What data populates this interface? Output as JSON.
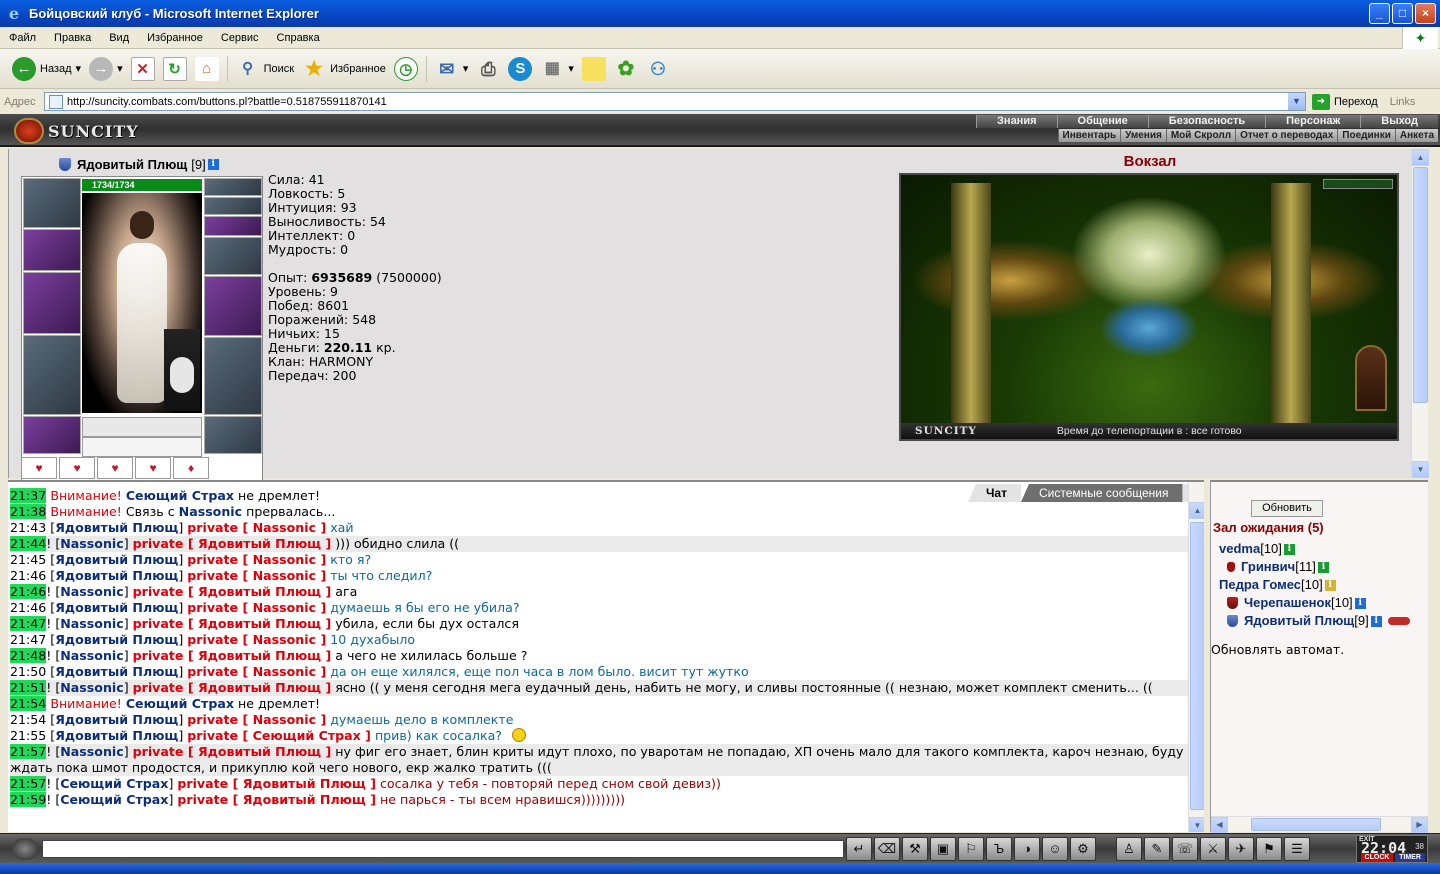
{
  "window": {
    "title": "Бойцовский клуб - Microsoft Internet Explorer",
    "btn_min": "_",
    "btn_max": "□",
    "btn_close": "×"
  },
  "menu": [
    "Файл",
    "Правка",
    "Вид",
    "Избранное",
    "Сервис",
    "Справка"
  ],
  "toolbar": {
    "back": "Назад",
    "search": "Поиск",
    "favorites": "Избранное"
  },
  "address": {
    "label": "Адрес",
    "url": "http://suncity.combats.com/buttons.pl?battle=0.518755911870141",
    "go": "Переход",
    "links": "Links"
  },
  "game_nav": {
    "logo": "SUNCITY",
    "row1": [
      "Знания",
      "Общение",
      "Безопасность",
      "Персонаж",
      "Выход"
    ],
    "row2": [
      "Инвентарь",
      "Умения",
      "Мой Скролл",
      "Отчет о переводах",
      "Поединки",
      "Анкета"
    ]
  },
  "character": {
    "name": "Ядовитый Плющ",
    "level": "[9]",
    "hp": "1734/1734",
    "stats": [
      {
        "label": "Сила:",
        "value": "41"
      },
      {
        "label": "Ловкость:",
        "value": "5"
      },
      {
        "label": "Интуиция:",
        "value": "93"
      },
      {
        "label": "Выносливость:",
        "value": "54"
      },
      {
        "label": "Интеллект:",
        "value": "0"
      },
      {
        "label": "Мудрость:",
        "value": "0"
      }
    ],
    "exp_label": "Опыт:",
    "exp_value": "6935689",
    "exp_next": "(7500000)",
    "level_label": "Уровень:",
    "level_value": "9",
    "wins_label": "Побед:",
    "wins_value": "8601",
    "losses_label": "Поражений:",
    "losses_value": "548",
    "draws_label": "Ничьих:",
    "draws_value": "15",
    "money_label": "Деньги:",
    "money_value": "220.11",
    "money_unit": "кр.",
    "clan_label": "Клан:",
    "clan_value": "HARMONY",
    "transfers_label": "Передач:",
    "transfers_value": "200"
  },
  "location": {
    "title": "Вокзал",
    "logo": "SUNCITY",
    "teleport": "Время до телепортации в : все готово"
  },
  "chat_tabs": {
    "chat": "Чат",
    "system": "Системные сообщения"
  },
  "chat": [
    {
      "t": "21:37",
      "green": true,
      "kind": "warn",
      "pre": "Внимание! ",
      "nick": "Сеющий Страх",
      "text": " не дремлет!"
    },
    {
      "t": "21:38",
      "green": true,
      "kind": "warn2",
      "pre": "Внимание! ",
      "text1": "Связь с ",
      "nick": "Nassonic",
      "text": " прервалась..."
    },
    {
      "t": "21:43",
      "green": false,
      "from": "Ядовитый Плющ",
      "to": "Nassonic",
      "msg": "хай",
      "mc": "msg-blue"
    },
    {
      "t": "21:44",
      "green": true,
      "from": "Nassonic",
      "to": "Ядовитый Плющ",
      "msg": "))) обидно слила ((",
      "mc": "",
      "hl": true
    },
    {
      "t": "21:45",
      "green": false,
      "from": "Ядовитый Плющ",
      "to": "Nassonic",
      "msg": "кто я?",
      "mc": "msg-blue"
    },
    {
      "t": "21:46",
      "green": false,
      "from": "Ядовитый Плющ",
      "to": "Nassonic",
      "msg": "ты что следил?",
      "mc": "msg-blue"
    },
    {
      "t": "21:46",
      "green": true,
      "from": "Nassonic",
      "to": "Ядовитый Плющ",
      "msg": "ага",
      "mc": ""
    },
    {
      "t": "21:46",
      "green": false,
      "from": "Ядовитый Плющ",
      "to": "Nassonic",
      "msg": "думаешь я бы его не убила?",
      "mc": "msg-blue"
    },
    {
      "t": "21:47",
      "green": true,
      "from": "Nassonic",
      "to": "Ядовитый Плющ",
      "msg": "убила, если бы дух остался",
      "mc": ""
    },
    {
      "t": "21:47",
      "green": false,
      "from": "Ядовитый Плющ",
      "to": "Nassonic",
      "msg": "10 духабыло",
      "mc": "msg-blue"
    },
    {
      "t": "21:48",
      "green": true,
      "from": "Nassonic",
      "to": "Ядовитый Плющ",
      "msg": "а чего не хилилась больше ?",
      "mc": ""
    },
    {
      "t": "21:50",
      "green": false,
      "from": "Ядовитый Плющ",
      "to": "Nassonic",
      "msg": "да он еще хилялся, еще пол часа в лом было. висит тут жутко",
      "mc": "msg-blue"
    },
    {
      "t": "21:51",
      "green": true,
      "from": "Nassonic",
      "to": "Ядовитый Плющ",
      "msg": "ясно (( у меня сегодня мега еудачный день, набить не могу, и сливы постоянные (( незнаю, может комплект сменить... ((",
      "mc": "",
      "wrap": true
    },
    {
      "t": "21:54",
      "green": true,
      "kind": "warn",
      "pre": "Внимание! ",
      "nick": "Сеющий Страх",
      "text": " не дремлет!"
    },
    {
      "t": "21:54",
      "green": false,
      "from": "Ядовитый Плющ",
      "to": "Nassonic",
      "msg": "думаешь дело в комплекте",
      "mc": "msg-blue"
    },
    {
      "t": "21:55",
      "green": false,
      "from": "Ядовитый Плющ",
      "to": "Сеющий Страх",
      "msg": "прив) как сосалка?",
      "mc": "msg-blue",
      "smile": true
    },
    {
      "t": "21:57",
      "green": true,
      "from": "Nassonic",
      "to": "Ядовитый Плющ",
      "msg": "ну фиг его знает, блин криты идут плохо, по уваротам не попадаю, ХП очень мало для такого комплекта, кароч незнаю, буду ждать пока шмот продостся, и прикуплю кой чего нового, екр жалко тратить (((",
      "mc": "",
      "wrap": true
    },
    {
      "t": "21:57",
      "green": true,
      "from": "Сеющий Страх",
      "to": "Ядовитый Плющ",
      "msg": "сосалка у тебя - повторяй перед сном свой девиз))",
      "mc": "msg-maroon"
    },
    {
      "t": "21:59",
      "green": true,
      "from": "Сеющий Страх",
      "to": "Ядовитый Плющ",
      "msg": "не парься - ты всем нравишся)))))))))",
      "mc": "msg-maroon"
    }
  ],
  "chat_words": {
    "private": "private",
    "lb": "[ ",
    "rb": " ]"
  },
  "right_panel": {
    "refresh": "Обновить",
    "room": "Зал ожидания (5)",
    "users": [
      {
        "name": "vedma",
        "level": "[10]",
        "indent": 0,
        "mark": "none",
        "info": "green"
      },
      {
        "name": "Гринвич",
        "level": "[11]",
        "indent": 1,
        "mark": "drop",
        "info": "green"
      },
      {
        "name": "Педра Гомес",
        "level": "[10]",
        "indent": 0,
        "mark": "none",
        "info": "yellow"
      },
      {
        "name": "Черепашенок",
        "level": "[10]",
        "indent": 1,
        "mark": "red",
        "info": "blue"
      },
      {
        "name": "Ядовитый Плющ",
        "level": "[9]",
        "indent": 1,
        "mark": "blue",
        "info": "blue",
        "trauma": true
      }
    ],
    "auto": "Обновлять автомат."
  },
  "clock": {
    "exit": "EXIT",
    "time": "22:04",
    "sec": "38",
    "l1": "CLOCK",
    "l2": "TIMER"
  }
}
